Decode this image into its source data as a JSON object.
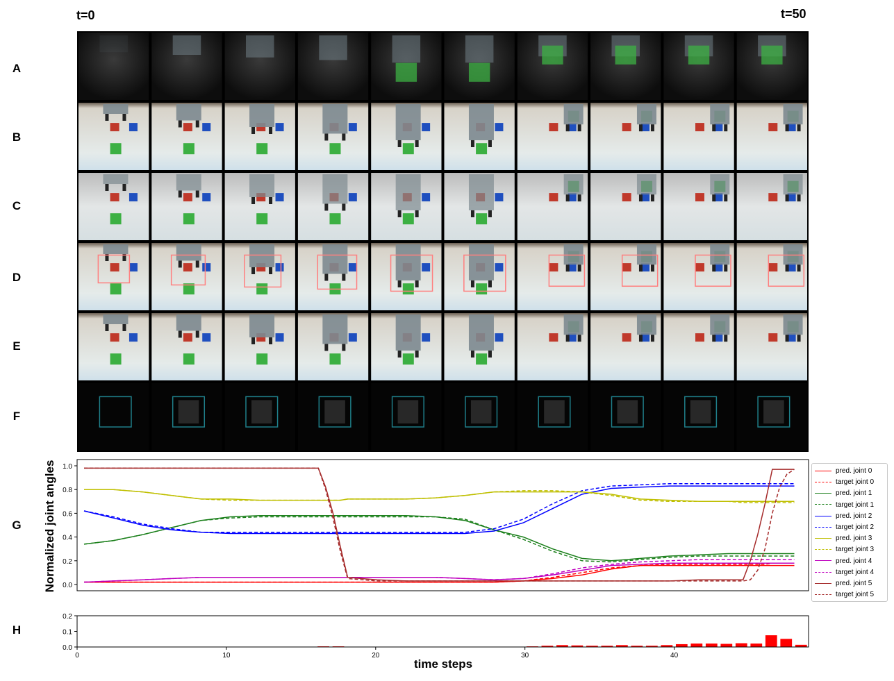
{
  "header": {
    "t_start": "t=0",
    "t_end": "t=50"
  },
  "rows": [
    "A",
    "B",
    "C",
    "D",
    "E",
    "F",
    "G",
    "H"
  ],
  "frames": 10,
  "colors": {
    "joint0": "#ff0000",
    "joint1": "#1a7f1a",
    "joint2": "#0000ff",
    "joint3": "#bfbf00",
    "joint4": "#bf00bf",
    "joint5": "#a52a2a",
    "bbox": "#ff7f7f",
    "green_cube": "#3cb043",
    "red_cube": "#c0392b",
    "blue_cube": "#1f4fbf"
  },
  "chart_data": [
    {
      "type": "line",
      "panel": "G",
      "ylabel": "Normalized joint angles",
      "xlim": [
        0,
        49
      ],
      "ylim": [
        0,
        1.0
      ],
      "yticks": [
        "0.0",
        "0.2",
        "0.4",
        "0.6",
        "0.8",
        "1.0"
      ],
      "grid": false,
      "legend_placement": "outside-right",
      "x": [
        0,
        2,
        4,
        6,
        8,
        10,
        12,
        14,
        16,
        16.5,
        17,
        17.5,
        18,
        20,
        22,
        24,
        26,
        28,
        30,
        32,
        34,
        36,
        38,
        40,
        42,
        44,
        45,
        45.5,
        46,
        46.5,
        47,
        47.5,
        48,
        48.5
      ],
      "series": [
        {
          "name": "pred. joint 0",
          "style": "solid",
          "color": "joint0",
          "values": [
            0.02,
            0.02,
            0.02,
            0.02,
            0.02,
            0.02,
            0.02,
            0.02,
            0.02,
            0.02,
            0.02,
            0.02,
            0.02,
            0.02,
            0.02,
            0.02,
            0.02,
            0.02,
            0.03,
            0.05,
            0.08,
            0.13,
            0.16,
            0.16,
            0.16,
            0.16,
            0.16,
            0.16,
            0.16,
            0.16,
            0.16,
            0.16,
            0.16,
            0.16
          ]
        },
        {
          "name": "target joint 0",
          "style": "dashed",
          "color": "joint0",
          "values": [
            0.02,
            0.02,
            0.02,
            0.02,
            0.02,
            0.02,
            0.02,
            0.02,
            0.02,
            0.02,
            0.02,
            0.02,
            0.02,
            0.02,
            0.02,
            0.02,
            0.02,
            0.02,
            0.03,
            0.06,
            0.1,
            0.14,
            0.16,
            0.17,
            0.17,
            0.17,
            0.17,
            0.17,
            0.17,
            0.17,
            0.18,
            0.18,
            0.18,
            0.18
          ]
        },
        {
          "name": "pred. joint 1",
          "style": "solid",
          "color": "joint1",
          "values": [
            0.34,
            0.37,
            0.42,
            0.48,
            0.54,
            0.57,
            0.58,
            0.58,
            0.58,
            0.58,
            0.58,
            0.58,
            0.58,
            0.58,
            0.58,
            0.57,
            0.54,
            0.46,
            0.4,
            0.3,
            0.22,
            0.2,
            0.22,
            0.24,
            0.25,
            0.26,
            0.26,
            0.26,
            0.26,
            0.26,
            0.26,
            0.26,
            0.26,
            0.26
          ]
        },
        {
          "name": "target joint 1",
          "style": "dashed",
          "color": "joint1",
          "values": [
            0.34,
            0.37,
            0.42,
            0.48,
            0.54,
            0.56,
            0.57,
            0.57,
            0.57,
            0.57,
            0.57,
            0.57,
            0.57,
            0.57,
            0.57,
            0.57,
            0.55,
            0.46,
            0.38,
            0.28,
            0.2,
            0.19,
            0.21,
            0.23,
            0.24,
            0.24,
            0.24,
            0.24,
            0.24,
            0.24,
            0.24,
            0.24,
            0.24,
            0.24
          ]
        },
        {
          "name": "pred. joint 2",
          "style": "solid",
          "color": "joint2",
          "values": [
            0.62,
            0.56,
            0.5,
            0.46,
            0.44,
            0.43,
            0.43,
            0.43,
            0.43,
            0.43,
            0.43,
            0.43,
            0.43,
            0.43,
            0.43,
            0.43,
            0.43,
            0.45,
            0.52,
            0.64,
            0.76,
            0.81,
            0.82,
            0.83,
            0.83,
            0.83,
            0.83,
            0.83,
            0.83,
            0.83,
            0.83,
            0.83,
            0.83,
            0.83
          ]
        },
        {
          "name": "target joint 2",
          "style": "dashed",
          "color": "joint2",
          "values": [
            0.62,
            0.57,
            0.51,
            0.47,
            0.44,
            0.44,
            0.44,
            0.44,
            0.44,
            0.44,
            0.44,
            0.44,
            0.44,
            0.44,
            0.44,
            0.44,
            0.44,
            0.47,
            0.55,
            0.68,
            0.79,
            0.83,
            0.84,
            0.85,
            0.85,
            0.85,
            0.85,
            0.85,
            0.85,
            0.85,
            0.85,
            0.85,
            0.85,
            0.85
          ]
        },
        {
          "name": "pred. joint 3",
          "style": "solid",
          "color": "joint3",
          "values": [
            0.8,
            0.8,
            0.78,
            0.75,
            0.72,
            0.72,
            0.71,
            0.71,
            0.71,
            0.71,
            0.71,
            0.71,
            0.72,
            0.72,
            0.72,
            0.73,
            0.75,
            0.78,
            0.78,
            0.78,
            0.78,
            0.76,
            0.72,
            0.71,
            0.7,
            0.7,
            0.7,
            0.7,
            0.7,
            0.7,
            0.7,
            0.7,
            0.7,
            0.7
          ]
        },
        {
          "name": "target joint 3",
          "style": "dashed",
          "color": "joint3",
          "values": [
            0.8,
            0.8,
            0.78,
            0.75,
            0.72,
            0.71,
            0.71,
            0.71,
            0.71,
            0.71,
            0.71,
            0.71,
            0.72,
            0.72,
            0.72,
            0.73,
            0.75,
            0.78,
            0.79,
            0.79,
            0.78,
            0.75,
            0.71,
            0.7,
            0.7,
            0.7,
            0.69,
            0.69,
            0.69,
            0.69,
            0.69,
            0.69,
            0.69,
            0.69
          ]
        },
        {
          "name": "pred. joint 4",
          "style": "solid",
          "color": "joint4",
          "values": [
            0.02,
            0.03,
            0.04,
            0.05,
            0.06,
            0.06,
            0.06,
            0.06,
            0.06,
            0.06,
            0.06,
            0.06,
            0.06,
            0.06,
            0.06,
            0.06,
            0.05,
            0.04,
            0.05,
            0.08,
            0.12,
            0.16,
            0.17,
            0.18,
            0.18,
            0.18,
            0.18,
            0.18,
            0.18,
            0.18,
            0.18,
            0.18,
            0.18,
            0.18
          ]
        },
        {
          "name": "target joint 4",
          "style": "dashed",
          "color": "joint4",
          "values": [
            0.02,
            0.03,
            0.04,
            0.05,
            0.06,
            0.06,
            0.06,
            0.06,
            0.06,
            0.06,
            0.06,
            0.06,
            0.06,
            0.06,
            0.06,
            0.06,
            0.05,
            0.04,
            0.05,
            0.09,
            0.14,
            0.17,
            0.19,
            0.2,
            0.21,
            0.21,
            0.21,
            0.21,
            0.21,
            0.21,
            0.21,
            0.21,
            0.21,
            0.21
          ]
        },
        {
          "name": "pred. joint 5",
          "style": "solid",
          "color": "joint5",
          "values": [
            0.98,
            0.98,
            0.98,
            0.98,
            0.98,
            0.98,
            0.98,
            0.98,
            0.98,
            0.82,
            0.6,
            0.32,
            0.06,
            0.04,
            0.03,
            0.03,
            0.03,
            0.03,
            0.03,
            0.03,
            0.03,
            0.03,
            0.03,
            0.03,
            0.04,
            0.04,
            0.04,
            0.2,
            0.42,
            0.68,
            0.97,
            0.97,
            0.97,
            0.97
          ]
        },
        {
          "name": "target joint 5",
          "style": "dashed",
          "color": "joint5",
          "values": [
            0.98,
            0.98,
            0.98,
            0.98,
            0.98,
            0.98,
            0.98,
            0.98,
            0.98,
            0.8,
            0.56,
            0.28,
            0.05,
            0.03,
            0.03,
            0.03,
            0.03,
            0.03,
            0.03,
            0.03,
            0.03,
            0.03,
            0.03,
            0.03,
            0.03,
            0.03,
            0.03,
            0.04,
            0.12,
            0.3,
            0.6,
            0.82,
            0.93,
            0.97
          ]
        }
      ]
    },
    {
      "type": "bar",
      "panel": "H",
      "xlabel": "time steps",
      "xlim": [
        0,
        49
      ],
      "ylim": [
        0,
        0.2
      ],
      "yticks": [
        "0.0",
        "0.1",
        "0.2"
      ],
      "xticks": [
        "0",
        "10",
        "20",
        "30",
        "40"
      ],
      "color": "joint0",
      "x": [
        0,
        1,
        2,
        3,
        4,
        5,
        6,
        7,
        8,
        9,
        10,
        11,
        12,
        13,
        14,
        15,
        16,
        17,
        18,
        19,
        20,
        21,
        22,
        23,
        24,
        25,
        26,
        27,
        28,
        29,
        30,
        31,
        32,
        33,
        34,
        35,
        36,
        37,
        38,
        39,
        40,
        41,
        42,
        43,
        44,
        45,
        46,
        47,
        48
      ],
      "values": [
        0.002,
        0.002,
        0.002,
        0.002,
        0.002,
        0.002,
        0.002,
        0.002,
        0.002,
        0.002,
        0.002,
        0.002,
        0.002,
        0.002,
        0.002,
        0.002,
        0.004,
        0.004,
        0.002,
        0.002,
        0.002,
        0.002,
        0.002,
        0.002,
        0.002,
        0.002,
        0.002,
        0.002,
        0.002,
        0.002,
        0.004,
        0.008,
        0.012,
        0.01,
        0.008,
        0.008,
        0.012,
        0.008,
        0.008,
        0.012,
        0.018,
        0.022,
        0.022,
        0.02,
        0.024,
        0.022,
        0.075,
        0.052,
        0.014
      ]
    }
  ]
}
